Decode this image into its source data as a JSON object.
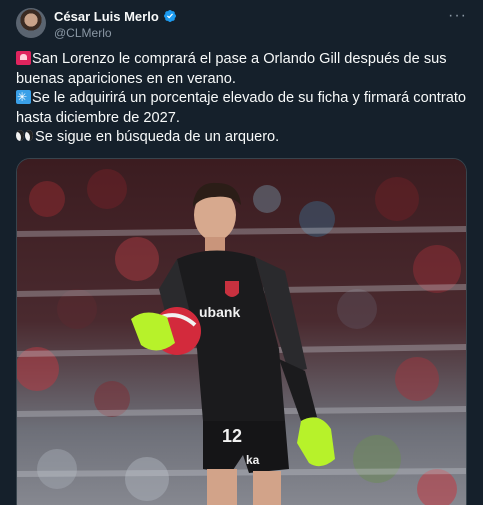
{
  "author": {
    "display_name": "César Luis Merlo",
    "handle": "@CLMerlo",
    "verified": true,
    "avatar_icon": "user-avatar"
  },
  "menu_icon": "more-horizontal-icon",
  "tweet": {
    "line1_emoji": "rotating-light-icon",
    "line1": "San Lorenzo le comprará el pase a Orlando Gill después de sus buenas apariciones en en verano.",
    "line2_emoji": "eight-spoked-asterisk-icon",
    "line2": "Se le adquirirá un porcentaje elevado de su ficha y firmará contrato hasta diciembre de 2027.",
    "line3_emoji": "eyes-icon",
    "line3": "Se sigue en búsqueda de un arquero."
  },
  "media": {
    "shirt_sponsor": "ubank",
    "shorts_number": "12",
    "shorts_brand": "ka",
    "colors": {
      "kit": "#1b1b1d",
      "gloves": "#b7f22a",
      "ball": "#d32a3c",
      "verified": "#1d9bf0"
    }
  }
}
